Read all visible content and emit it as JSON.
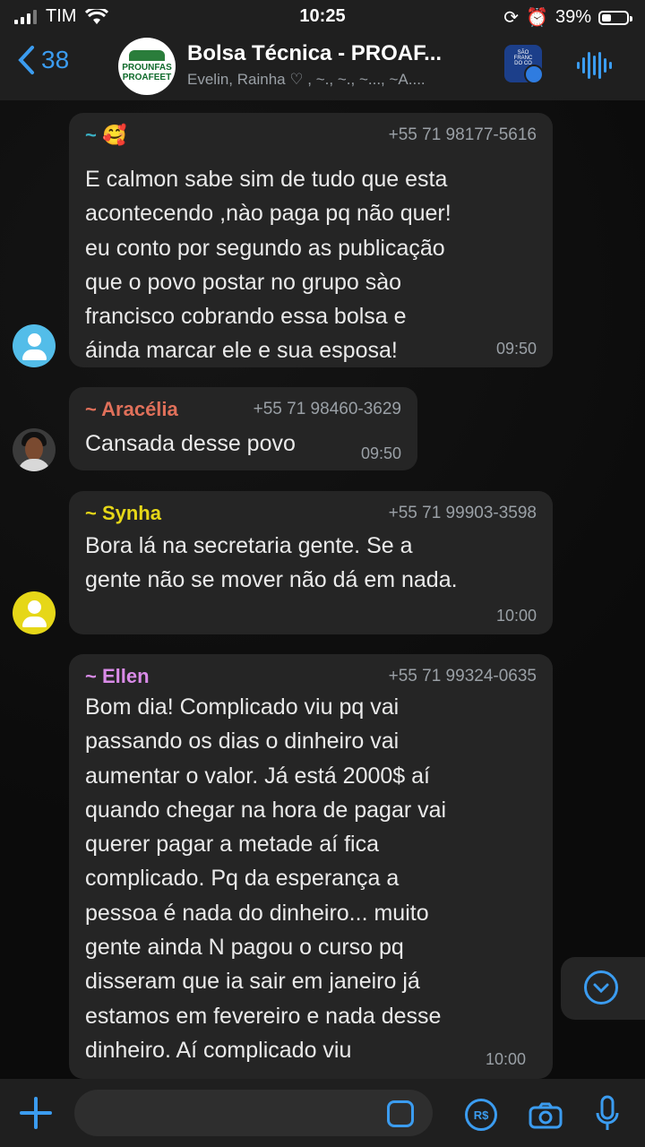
{
  "status_bar": {
    "carrier": "TIM",
    "time": "10:25",
    "battery_percent": "39%",
    "battery_level": 0.39
  },
  "header": {
    "back_count": "38",
    "group_title": "Bolsa Técnica - PROAF...",
    "members": "Evelin, Rainha ♡ , ~., ~., ~..., ~A....",
    "group_avatar_text_top": "PROUNFAS",
    "group_avatar_text_bottom": "PROAFEET",
    "community_label": "SÃO FRANC DO CO"
  },
  "messages": [
    {
      "sender": "~ 🥰",
      "sender_color": "#3ab0c4",
      "phone": "+55 71 98177-5616",
      "text": "E calmon sabe sim de tudo que esta\nacontecendo ,nào paga pq não quer!\neu conto por segundo as publicação\nque o povo postar no grupo sào\nfrancisco cobrando essa bolsa e\náinda marcar ele e sua esposa!",
      "time": "09:50"
    },
    {
      "sender": "~ Aracélia",
      "sender_color": "#e0705a",
      "phone": "+55 71 98460-3629",
      "text": "Cansada desse povo",
      "time": "09:50"
    },
    {
      "sender": "~ Synha",
      "sender_color": "#e6d718",
      "phone": "+55 71 99903-3598",
      "text": "Bora lá na secretaria gente. Se a\ngente não se mover não dá em nada.",
      "time": "10:00"
    },
    {
      "sender": "~ Ellen",
      "sender_color": "#d98be8",
      "phone": "+55 71 99324-0635",
      "text": "Bom dia!  Complicado viu pq vai\npassando os dias o dinheiro vai\naumentar o valor.  Já está 2000$ aí\nquando chegar na hora de pagar vai\nquerer pagar a metade aí fica\ncomplicado.  Pq da esperança a\npessoa é nada do dinheiro... muito\ngente ainda N pagou o curso pq\ndisseram que ia sair em janeiro já\nestamos em fevereiro e nada desse\ndinheiro.  Aí complicado viu",
      "time": "10:00"
    }
  ],
  "input": {
    "placeholder": "",
    "pay_label": "R$"
  },
  "icons": {
    "back": "chevron-left-icon",
    "audio": "audio-waveform-icon",
    "add": "plus-icon",
    "sticker": "sticker-icon",
    "pay": "pix-pay-icon",
    "camera": "camera-icon",
    "mic": "microphone-icon",
    "scroll": "chevron-down-icon"
  },
  "colors": {
    "accent": "#3b9cf0",
    "bubble": "#252525",
    "background": "#0b0b0b"
  }
}
